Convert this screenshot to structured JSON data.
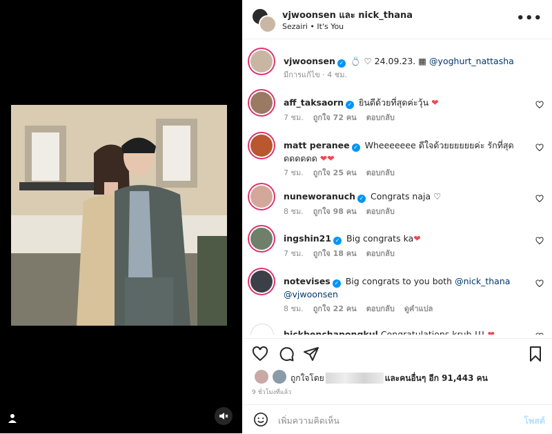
{
  "header": {
    "names": "vjwoonsen และ nick_thana",
    "audio": "Sezairi • It's You",
    "more": "•••"
  },
  "caption": {
    "username": "vjwoonsen",
    "text": "24.09.23.",
    "mention": "@yoghurt_nattasha",
    "meta": "มีการแก้ไข · 4 ชม."
  },
  "comments": [
    {
      "username": "aff_taksaorn",
      "text": "ยินดีด้วยที่สุดค่ะวุ้น",
      "time": "7 ชม.",
      "likes": "ถูกใจ 72 คน",
      "reply": "ตอบกลับ"
    },
    {
      "username": "matt peranee",
      "text": "Wheeeeeee ดีใจด้วยยยยยยค่ะ รักที่สุดดดดดดด",
      "time": "7 ชม.",
      "likes": "ถูกใจ 25 คน",
      "reply": "ตอบกลับ"
    },
    {
      "username": "nuneworanuch",
      "text": "Congrats naja",
      "time": "8 ชม.",
      "likes": "ถูกใจ 98 คน",
      "reply": "ตอบกลับ"
    },
    {
      "username": "ingshin21",
      "text": "Big congrats ka",
      "time": "7 ชม.",
      "likes": "ถูกใจ 18 คน",
      "reply": "ตอบกลับ"
    },
    {
      "username": "notevises",
      "text": "Big congrats to you both",
      "mention1": "@nick_thana",
      "mention2": "@vjwoonsen",
      "time": "8 ชม.",
      "likes": "ถูกใจ 22 คน",
      "reply": "ตอบกลับ",
      "translate": "ดูคำแปล"
    },
    {
      "username": "bickbenchapongkul",
      "text": "Congratulations krub !!!"
    }
  ],
  "likes": {
    "liked_by": "ถูกใจโดย",
    "others": "และคนอื่นๆ อีก 91,443 คน"
  },
  "time_ago": "9 ชั่วโมงที่แล้ว",
  "add_comment": {
    "placeholder": "เพิ่มความคิดเห็น",
    "post": "โพสต์"
  },
  "colors": {
    "accent": "#0095f6",
    "heart": "#ed4956",
    "post_disabled": "#b2dffc"
  }
}
